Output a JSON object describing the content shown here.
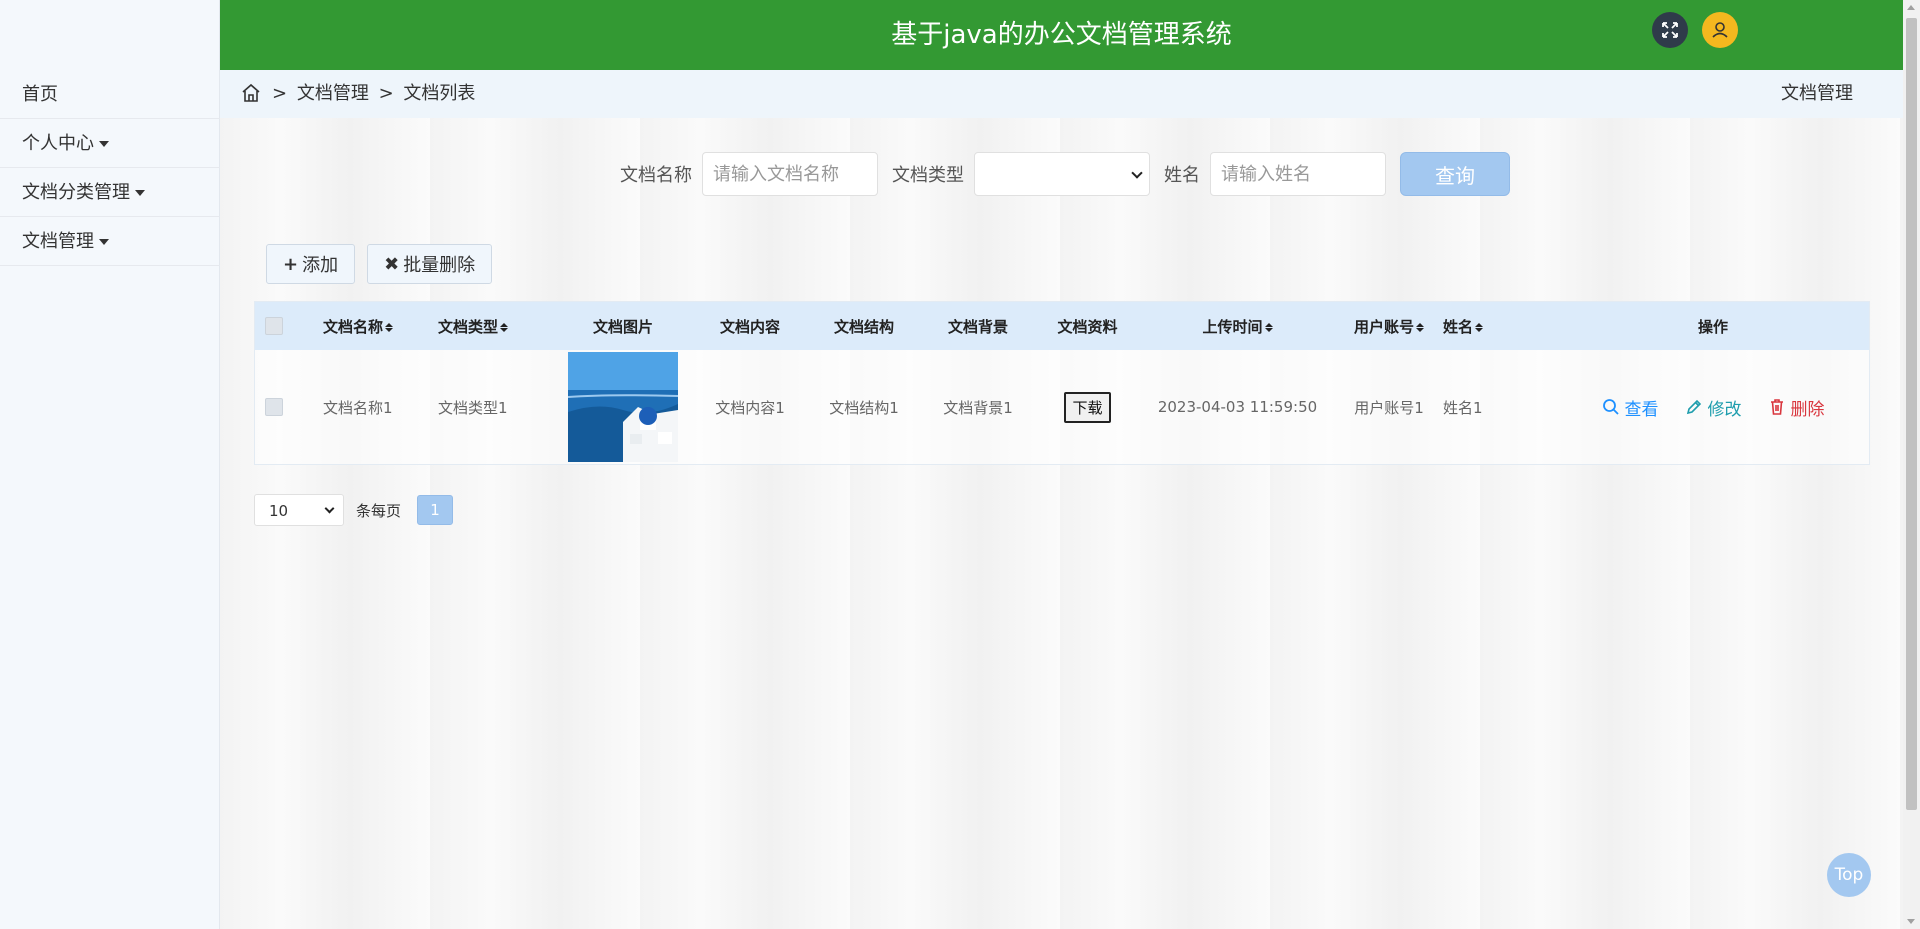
{
  "header": {
    "title": "基于java的办公文档管理系统"
  },
  "sidebar": {
    "items": [
      {
        "label": "首页",
        "has_caret": false
      },
      {
        "label": "个人中心",
        "has_caret": true
      },
      {
        "label": "文档分类管理",
        "has_caret": true
      },
      {
        "label": "文档管理",
        "has_caret": true
      }
    ]
  },
  "breadcrumb": {
    "sep": ">",
    "items": [
      "文档管理",
      "文档列表"
    ],
    "right_title": "文档管理"
  },
  "search": {
    "name_label": "文档名称",
    "name_placeholder": "请输入文档名称",
    "type_label": "文档类型",
    "type_value": "",
    "user_label": "姓名",
    "user_placeholder": "请输入姓名",
    "button": "查询"
  },
  "actions": {
    "add": "添加",
    "batch_delete": "批量删除"
  },
  "table": {
    "columns": [
      "文档名称",
      "文档类型",
      "文档图片",
      "文档内容",
      "文档结构",
      "文档背景",
      "文档资料",
      "上传时间",
      "用户账号",
      "姓名",
      "操作"
    ],
    "rows": [
      {
        "name": "文档名称1",
        "type": "文档类型1",
        "content": "文档内容1",
        "structure": "文档结构1",
        "background": "文档背景1",
        "file": "下载",
        "upload_time": "2023-04-03 11:59:50",
        "account": "用户账号1",
        "user_name": "姓名1"
      }
    ],
    "ops": {
      "view": "查看",
      "edit": "修改",
      "delete": "删除"
    }
  },
  "pagination": {
    "page_size": "10",
    "label": "条每页",
    "current": "1"
  },
  "top_button": "Top",
  "colors": {
    "header": "#339933",
    "primary_light": "#a3c8f0",
    "view": "#1e90ff",
    "edit": "#1e9dad",
    "delete": "#d9363e"
  },
  "icons": {
    "home": "home-icon",
    "fullscreen": "fullscreen-icon",
    "user": "user-icon",
    "search": "search-icon",
    "edit": "pencil-icon",
    "delete": "trash-icon"
  }
}
